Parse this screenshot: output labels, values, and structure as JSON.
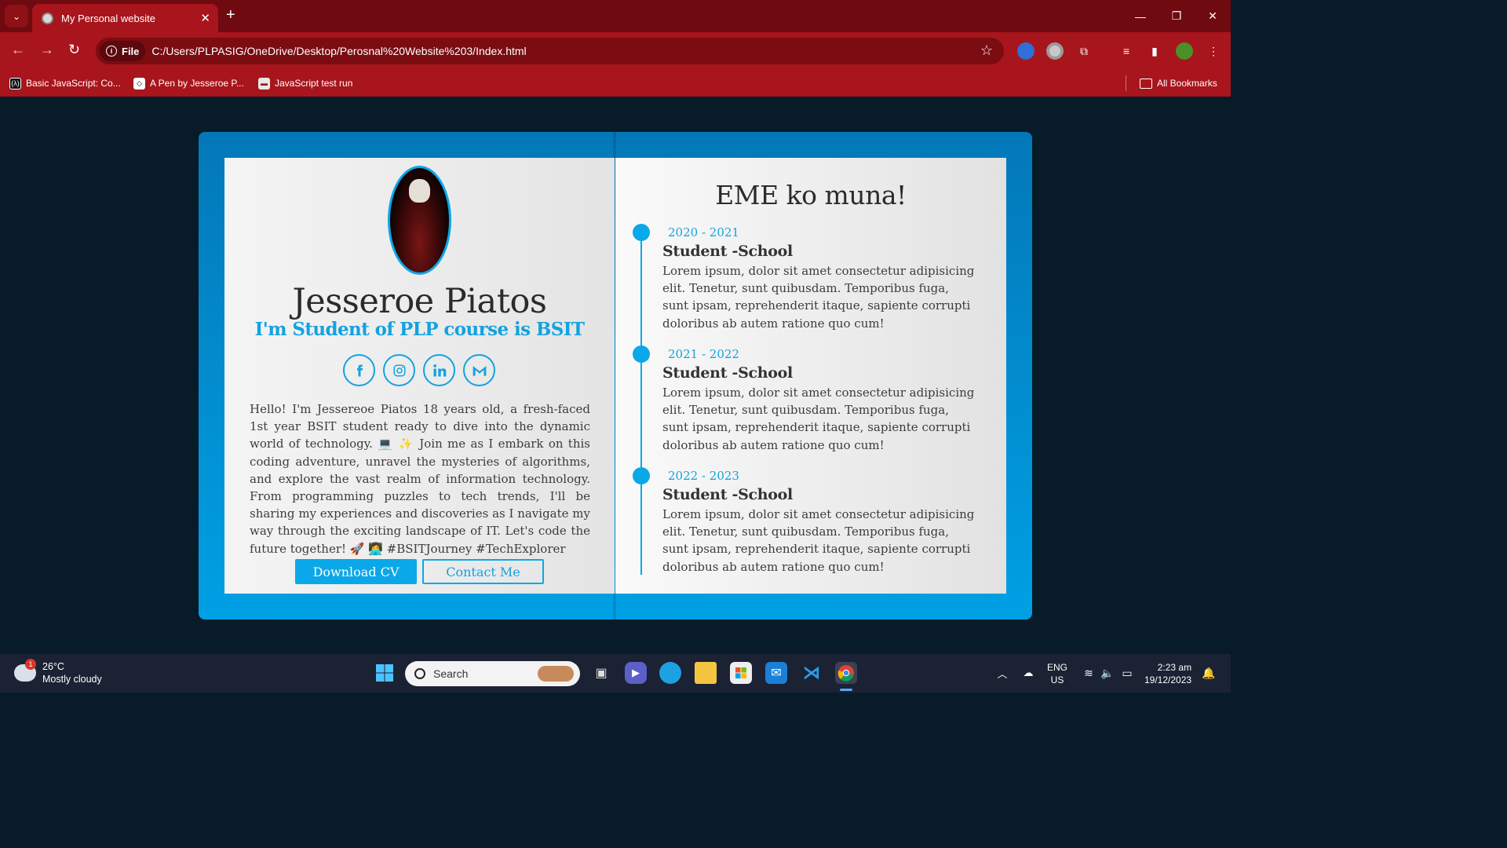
{
  "browser": {
    "tab_title": "My Personal website",
    "url_chip": "File",
    "url": "C:/Users/PLPASIG/OneDrive/Desktop/Perosnal%20Website%203/Index.html",
    "bookmarks": [
      {
        "label": "Basic JavaScript: Co..."
      },
      {
        "label": "A Pen by Jesseroe P..."
      },
      {
        "label": "JavaScript test run"
      }
    ],
    "all_bookmarks": "All Bookmarks"
  },
  "profile": {
    "name": "Jesseroe Piatos",
    "subtitle": "I'm Student of PLP course is BSIT",
    "socials": [
      "facebook-icon",
      "instagram-icon",
      "linkedin-icon",
      "gmail-icon"
    ],
    "bio": "Hello! I'm Jessereoe Piatos 18 years old, a fresh-faced 1st year BSIT student ready to dive into the dynamic world of technology. 💻 ✨  Join me as I embark on this coding adventure, unravel the mysteries of algorithms, and explore the vast realm of information technology. From programming puzzles to tech trends, I'll be sharing my experiences and discoveries as I navigate my way through the exciting landscape of IT. Let's code the future together! 🚀 👩‍💻 #BSITJourney #TechExplorer",
    "download_label": "Download CV",
    "contact_label": "Contact Me"
  },
  "timeline": {
    "title": "EME ko muna!",
    "items": [
      {
        "years": "2020 - 2021",
        "role": "Student -School",
        "text": "Lorem ipsum, dolor sit amet consectetur adipisicing elit. Tenetur, sunt quibusdam. Temporibus fuga, sunt ipsam, reprehenderit itaque, sapiente corrupti doloribus ab autem ratione quo cum!"
      },
      {
        "years": "2021 - 2022",
        "role": "Student -School",
        "text": "Lorem ipsum, dolor sit amet consectetur adipisicing elit. Tenetur, sunt quibusdam. Temporibus fuga, sunt ipsam, reprehenderit itaque, sapiente corrupti doloribus ab autem ratione quo cum!"
      },
      {
        "years": "2022 - 2023",
        "role": "Student -School",
        "text": "Lorem ipsum, dolor sit amet consectetur adipisicing elit. Tenetur, sunt quibusdam. Temporibus fuga, sunt ipsam, reprehenderit itaque, sapiente corrupti doloribus ab autem ratione quo cum!"
      }
    ]
  },
  "taskbar": {
    "weather_temp": "26°C",
    "weather_desc": "Mostly cloudy",
    "weather_badge": "1",
    "search_label": "Search",
    "lang_top": "ENG",
    "lang_bottom": "US",
    "time": "2:23 am",
    "date": "19/12/2023"
  },
  "colors": {
    "accent": "#0aa8e8",
    "background": "#081b29",
    "browser_frame": "#a8151c"
  }
}
